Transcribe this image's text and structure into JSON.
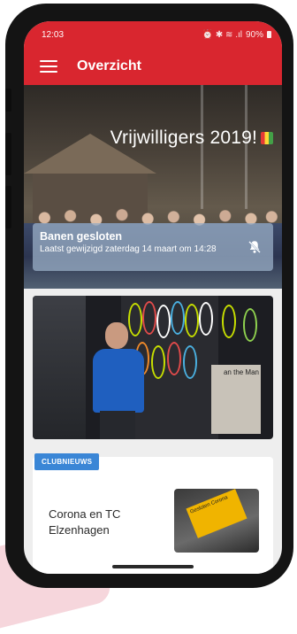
{
  "status_bar": {
    "time": "12:03",
    "icons": "⏰ ✱ ≋ .ıl",
    "battery": "90%"
  },
  "app_bar": {
    "title": "Overzicht",
    "menu_icon": "hamburger-menu-icon"
  },
  "hero": {
    "title": "Vrijwilligers 2019!"
  },
  "notice": {
    "title": "Banen gesloten",
    "subtitle": "Laatst gewijzigd zaterdag 14 maart om 14:28",
    "icon": "bell-off-icon"
  },
  "photo_card": {
    "poster_text": "an the Man"
  },
  "news_card": {
    "badge": "CLUBNIEUWS",
    "title": "Corona en TC Elzenhagen",
    "thumbnail_sign_text": "Gesloten Corona"
  },
  "colors": {
    "app_bar": "#d9262f",
    "badge": "#3a86d6",
    "notice": "#96aac3"
  }
}
